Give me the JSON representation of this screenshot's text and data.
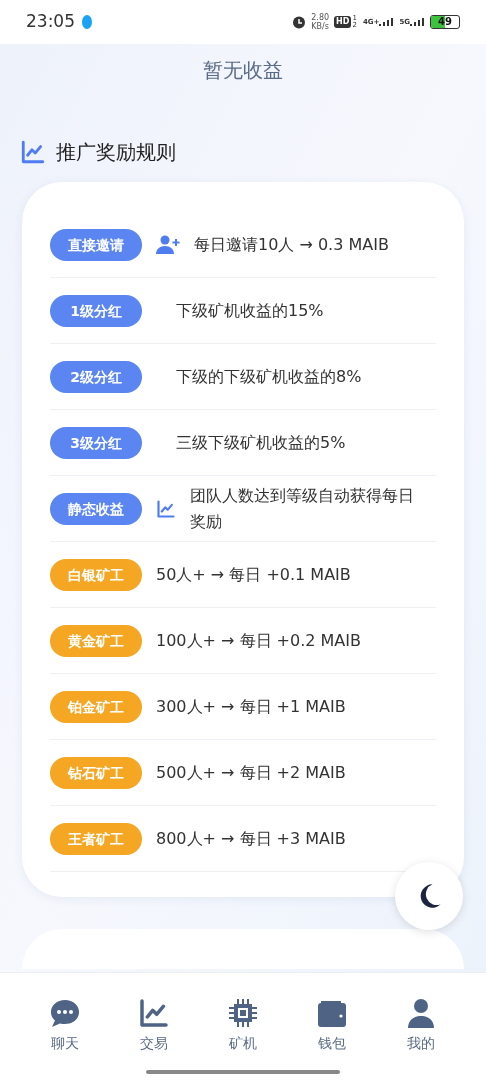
{
  "status_bar": {
    "time": "23:05",
    "speed_value": "2.80",
    "speed_unit": "KB/s",
    "hd": "HD",
    "hd_sims": [
      "1",
      "2"
    ],
    "network_1": "4G+",
    "network_2": "5G",
    "battery": "49"
  },
  "earnings": {
    "text": "暂无收益"
  },
  "section": {
    "title": "推广奖励规则"
  },
  "rules": [
    {
      "badge": "直接邀请",
      "kind": "invite",
      "text": "每日邀请10人 → 0.3 MAIB"
    },
    {
      "badge": "1级分红",
      "kind": "dividend",
      "text": "下级矿机收益的15%"
    },
    {
      "badge": "2级分红",
      "kind": "dividend",
      "text": "下级的下级矿机收益的8%"
    },
    {
      "badge": "3级分红",
      "kind": "dividend",
      "text": "三级下级矿机收益的5%"
    },
    {
      "badge": "静态收益",
      "kind": "static",
      "text": "团队人数达到等级自动获得每日奖励"
    },
    {
      "badge": "白银矿工",
      "kind": "tier",
      "text": "50人+ → 每日 +0.1 MAIB"
    },
    {
      "badge": "黄金矿工",
      "kind": "tier",
      "text": "100人+ → 每日 +0.2 MAIB"
    },
    {
      "badge": "铂金矿工",
      "kind": "tier",
      "text": "300人+ → 每日 +1 MAIB"
    },
    {
      "badge": "钻石矿工",
      "kind": "tier",
      "text": "500人+ → 每日 +2 MAIB"
    },
    {
      "badge": "王者矿工",
      "kind": "tier",
      "text": "800人+ → 每日 +3 MAIB"
    }
  ],
  "tabs": [
    {
      "label": "聊天",
      "selected": false
    },
    {
      "label": "交易",
      "selected": false
    },
    {
      "label": "矿机",
      "selected": false
    },
    {
      "label": "钱包",
      "selected": false
    },
    {
      "label": "我的",
      "selected": false
    }
  ]
}
